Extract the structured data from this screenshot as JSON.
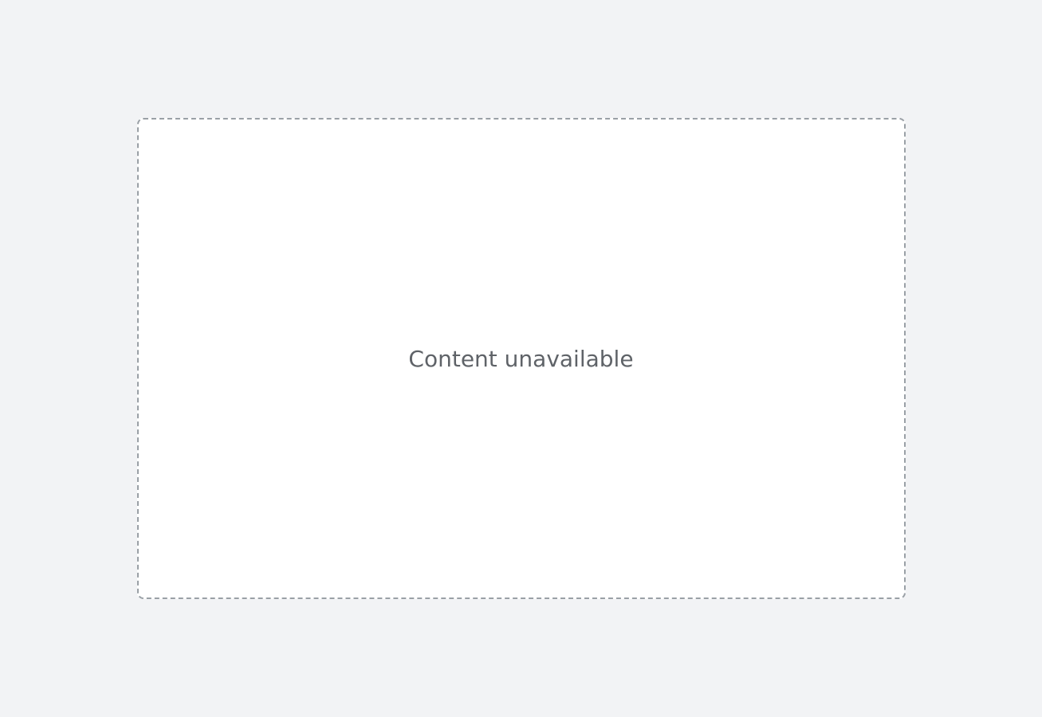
{
  "placeholder": {
    "label": "Content unavailable"
  }
}
